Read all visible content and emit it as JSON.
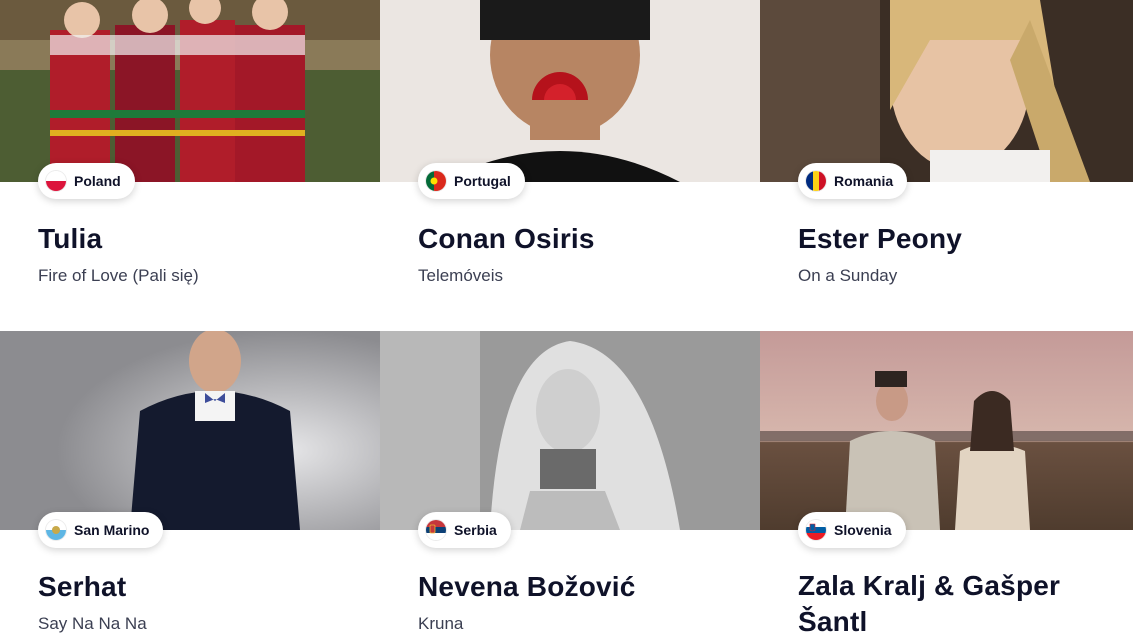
{
  "cards": [
    {
      "country": "Poland",
      "flag_icon": "poland-flag-icon",
      "artist": "Tulia",
      "song": "Fire of Love (Pali się)",
      "photo_colors": [
        "#5a6b3c",
        "#2e3a1e"
      ]
    },
    {
      "country": "Portugal",
      "flag_icon": "portugal-flag-icon",
      "artist": "Conan Osiris",
      "song": "Telemóveis",
      "photo_colors": [
        "#e8e4e0",
        "#c9c3bd"
      ]
    },
    {
      "country": "Romania",
      "flag_icon": "romania-flag-icon",
      "artist": "Ester Peony",
      "song": "On a Sunday",
      "photo_colors": [
        "#5d4a3b",
        "#2b221b"
      ]
    },
    {
      "country": "San Marino",
      "flag_icon": "san-marino-flag-icon",
      "artist": "Serhat",
      "song": "Say Na Na Na",
      "photo_colors": [
        "#c9c9cb",
        "#8a8a8e"
      ]
    },
    {
      "country": "Serbia",
      "flag_icon": "serbia-flag-icon",
      "artist": "Nevena Božović",
      "song": "Kruna",
      "photo_colors": [
        "#bdbdbd",
        "#7a7a7a"
      ]
    },
    {
      "country": "Slovenia",
      "flag_icon": "slovenia-flag-icon",
      "artist": "Zala Kralj & Gašper Šantl",
      "song": "",
      "photo_colors": [
        "#c8a8a0",
        "#6b5a4a"
      ]
    }
  ]
}
